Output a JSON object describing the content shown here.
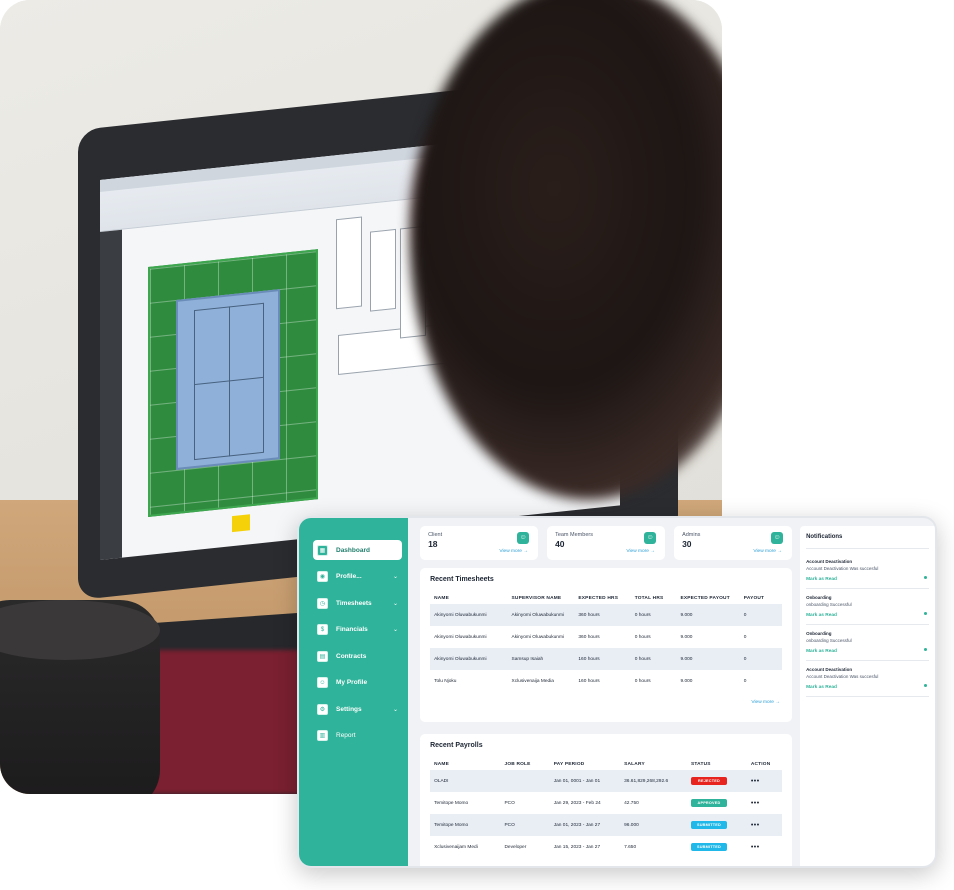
{
  "sidebar": {
    "items": [
      {
        "label": "Dashboard",
        "icon": "grid-icon",
        "active": true,
        "chevron": false
      },
      {
        "label": "Profile...",
        "icon": "user-icon",
        "active": false,
        "chevron": true
      },
      {
        "label": "Timesheets",
        "icon": "clock-icon",
        "active": false,
        "chevron": true
      },
      {
        "label": "Financials",
        "icon": "money-icon",
        "active": false,
        "chevron": true
      },
      {
        "label": "Contracts",
        "icon": "document-icon",
        "active": false,
        "chevron": false
      },
      {
        "label": "My Profile",
        "icon": "profile-icon",
        "active": false,
        "chevron": false
      },
      {
        "label": "Settings",
        "icon": "gear-icon",
        "active": false,
        "chevron": true
      },
      {
        "label": "Report",
        "icon": "chart-icon",
        "active": false,
        "chevron": false
      }
    ]
  },
  "stats": [
    {
      "name": "Client",
      "value": "18",
      "more": "View more →"
    },
    {
      "name": "Team Members",
      "value": "40",
      "more": "View more →"
    },
    {
      "name": "Admins",
      "value": "30",
      "more": "View more →"
    }
  ],
  "timesheets": {
    "title": "Recent Timesheets",
    "columns": [
      "NAME",
      "SUPERVISOR NAME",
      "EXPECTED HRS",
      "TOTAL HRS",
      "EXPECTED PAYOUT",
      "PAYOUT"
    ],
    "rows": [
      [
        "Akinyomi Oluwabukunmi",
        "Akinyomi Oluwabukunmi",
        "360 hours",
        "0 hours",
        "9.000",
        "0"
      ],
      [
        "Akinyomi Oluwabukunmi",
        "Akinyomi Oluwabukunmi",
        "360 hours",
        "0 hours",
        "9.000",
        "0"
      ],
      [
        "Akinyomi Oluwabukunmi",
        "Samsup Isaiah",
        "160 hours",
        "0 hours",
        "9.000",
        "0"
      ],
      [
        "Tolu Njoku",
        "Xclusivenaija Media",
        "160 hours",
        "0 hours",
        "9.000",
        "0"
      ]
    ],
    "view_more": "View more →"
  },
  "payrolls": {
    "title": "Recent Payrolls",
    "columns": [
      "NAME",
      "JOB ROLE",
      "PAY PERIOD",
      "SALARY",
      "STATUS",
      "ACTION"
    ],
    "rows": [
      {
        "name": "OLADI",
        "role": "",
        "period": "Jan 01, 0001 - Jan 01",
        "salary": "36.61,829,268,292.6",
        "status": "REJECTED",
        "status_color": "#e8241f",
        "action": "•••"
      },
      {
        "name": "Temitope Momo",
        "role": "PCO",
        "period": "Jan 29, 2023 - Feb 24",
        "salary": "42.750",
        "status": "APPROVED",
        "status_color": "#2fb39a",
        "action": "•••"
      },
      {
        "name": "Temitope Momo",
        "role": "PCO",
        "period": "Jan 01, 2023 - Jan 27",
        "salary": "96.000",
        "status": "SUBMITTED",
        "status_color": "#20b8e8",
        "action": "•••"
      },
      {
        "name": "Xclusivenaijam Medi",
        "role": "Developer",
        "period": "Jan 15, 2023 - Jan 27",
        "salary": "7.650",
        "status": "SUBMITTED",
        "status_color": "#20b8e8",
        "action": "•••"
      }
    ]
  },
  "notifications": {
    "title": "Notifications",
    "items": [
      {
        "title": "Account Deactivation",
        "body": "Account Deactivation Was succesful",
        "action": "Mark as Read"
      },
      {
        "title": "Onboarding",
        "body": "onboarding Successful",
        "action": "Mark as Read"
      },
      {
        "title": "Onboarding",
        "body": "onboarding Successful",
        "action": "Mark as Read"
      },
      {
        "title": "Account Deactivation",
        "body": "Account Deactivation Was succesful",
        "action": "Mark as Read"
      }
    ]
  },
  "colors": {
    "accent": "#2fb39a",
    "link": "#2a9fd6",
    "rejected": "#e8241f",
    "submitted": "#20b8e8"
  }
}
